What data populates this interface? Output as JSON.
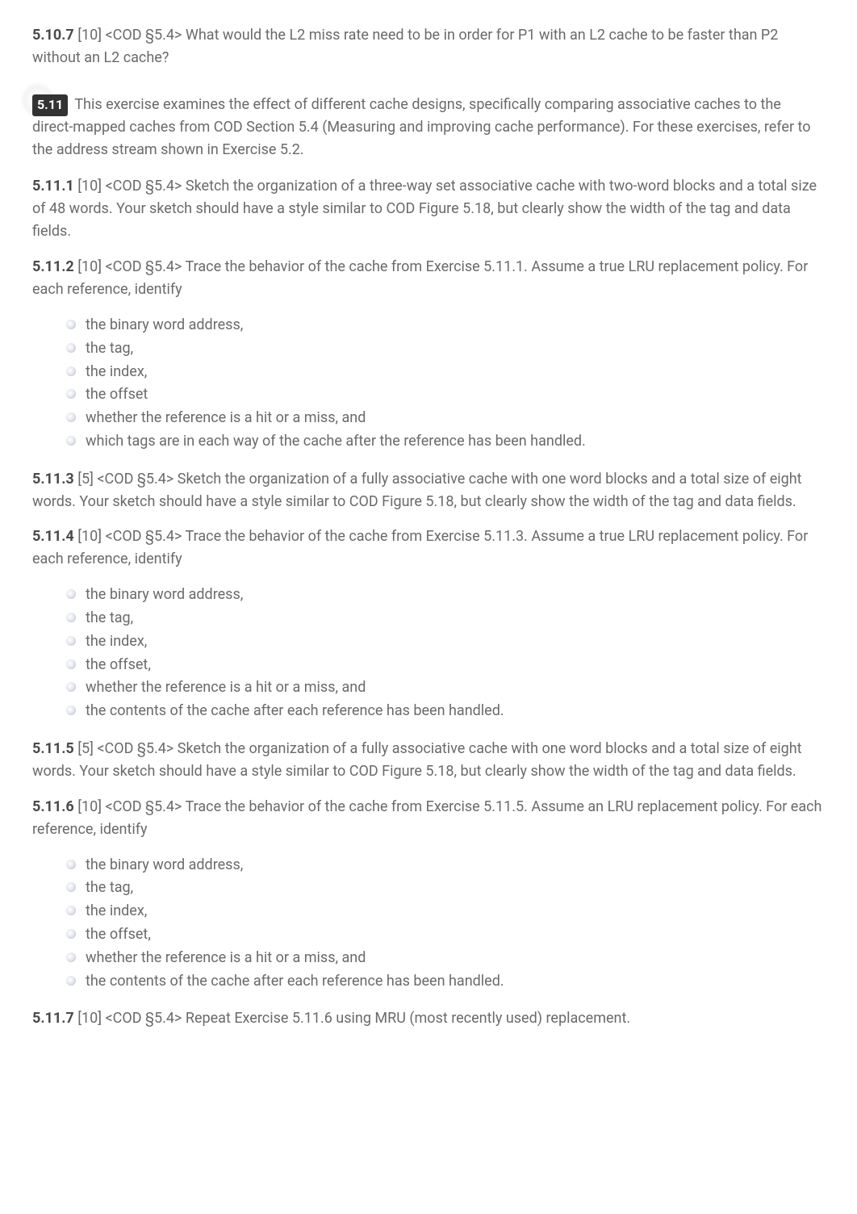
{
  "exercises": {
    "e5_10_7": {
      "num": "5.10.7",
      "meta": "[10] <COD §5.4>",
      "text": "What would the L2 miss rate need to be in order for P1 with an L2 cache to be faster than P2 without an L2 cache?"
    },
    "e5_11_intro": {
      "badge": "5.11",
      "text": "This exercise examines the effect of different cache designs, specifically comparing associative caches to the direct-mapped caches from COD Section 5.4 (Measuring and improving cache performance). For these exercises, refer to the address stream shown in Exercise 5.2."
    },
    "e5_11_1": {
      "num": "5.11.1",
      "meta": "[10] <COD §5.4>",
      "text": "Sketch the organization of a three-way set associative cache with two-word blocks and a total size of 48 words. Your sketch should have a style similar to COD Figure 5.18, but clearly show the width of the tag and data fields."
    },
    "e5_11_2": {
      "num": "5.11.2",
      "meta": "[10] <COD §5.4>",
      "text": "Trace the behavior of the cache from Exercise 5.11.1. Assume a true LRU replacement policy. For each reference, identify"
    },
    "list_5_11_2": [
      "the binary word address,",
      "the tag,",
      "the index,",
      "the offset",
      "whether the reference is a hit or a miss, and",
      "which tags are in each way of the cache after the reference has been handled."
    ],
    "e5_11_3": {
      "num": "5.11.3",
      "meta": "[5] <COD §5.4>",
      "text": "Sketch the organization of a fully associative cache with one word blocks and a total size of eight words. Your sketch should have a style similar to COD Figure 5.18, but clearly show the width of the tag and data fields."
    },
    "e5_11_4": {
      "num": "5.11.4",
      "meta": "[10] <COD §5.4>",
      "text": "Trace the behavior of the cache from Exercise 5.11.3. Assume a true LRU replacement policy. For each reference, identify"
    },
    "list_5_11_4": [
      "the binary word address,",
      "the tag,",
      "the index,",
      "the offset,",
      "whether the reference is a hit or a miss, and",
      "the contents of the cache after each reference has been handled."
    ],
    "e5_11_5": {
      "num": "5.11.5",
      "meta": "[5] <COD §5.4>",
      "text": "Sketch the organization of a fully associative cache with one word blocks and a total size of eight words. Your sketch should have a style similar to COD Figure 5.18, but clearly show the width of the tag and data fields."
    },
    "e5_11_6": {
      "num": "5.11.6",
      "meta": "[10] <COD §5.4>",
      "text": "Trace the behavior of the cache from Exercise 5.11.5. Assume an LRU replacement policy. For each reference, identify"
    },
    "list_5_11_6": [
      "the binary word address,",
      "the tag,",
      "the index,",
      "the offset,",
      "whether the reference is a hit or a miss, and",
      "the contents of the cache after each reference has been handled."
    ],
    "e5_11_7": {
      "num": "5.11.7",
      "meta": "[10] <COD §5.4>",
      "text": "Repeat Exercise 5.11.6 using MRU (most recently used) replacement."
    }
  }
}
